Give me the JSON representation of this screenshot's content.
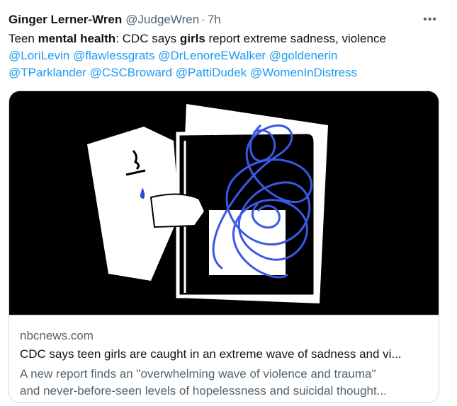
{
  "tweet": {
    "author_name": "Ginger Lerner-Wren",
    "handle": "@JudgeWren",
    "separator": "·",
    "time": "7h",
    "more_icon": "ellipsis-icon",
    "text_parts": {
      "p1": "Teen ",
      "b1": "mental health",
      "p2": ": CDC says ",
      "b2": "girls",
      "p3": " report extreme sadness, violence"
    },
    "mentions": [
      "@LoriLevin",
      "@flawlessgrats",
      "@DrLenoreEWalker",
      "@goldenerin",
      "@TParklander",
      "@CSCBroward",
      "@PattiDudek",
      "@WomenInDistress"
    ]
  },
  "card": {
    "domain": "nbcnews.com",
    "title": "CDC says teen girls are caught in an extreme wave of sadness and vi...",
    "description_line1": "A new report finds an \"overwhelming wave of violence and trauma\"",
    "description_line2": "and never-before-seen levels of hopelessness and suicidal thought...",
    "colors": {
      "media_bg": "#000000",
      "scribble": "#3b57e6",
      "tear": "#2e4fd6"
    }
  },
  "colors": {
    "link": "#1d9bf0",
    "muted": "#536471",
    "text": "#0f1419",
    "border": "#cfd9de"
  }
}
